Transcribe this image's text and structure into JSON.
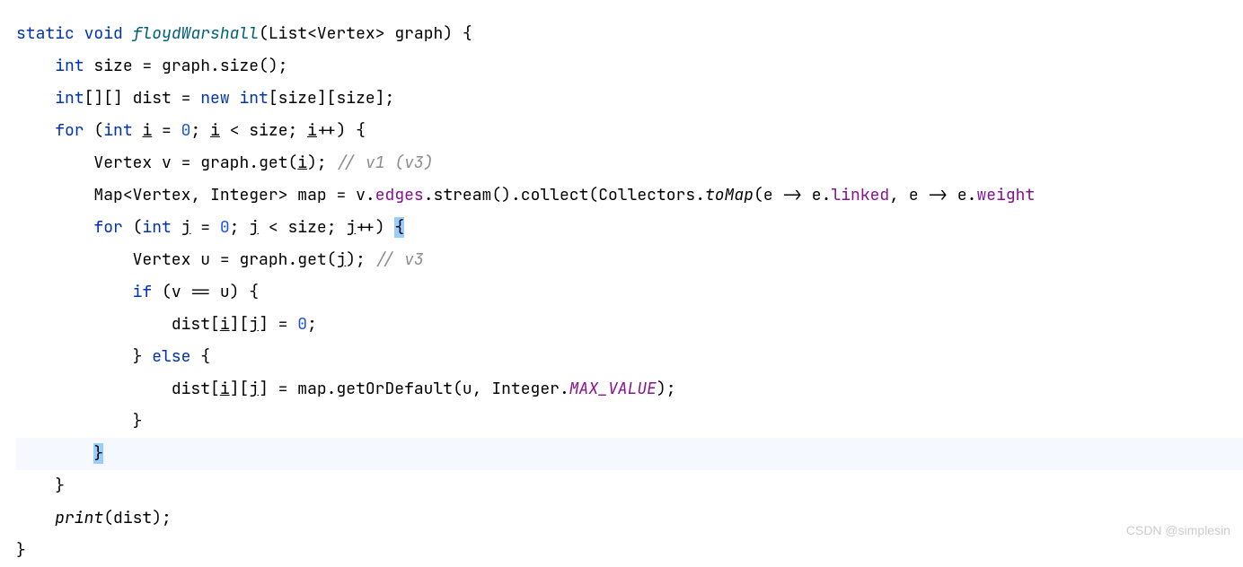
{
  "code": {
    "l1": {
      "kw_static": "static",
      "kw_void": "void",
      "method": "floydWarshall",
      "p1": "(",
      "type_list": "List",
      "lt": "<",
      "type_vertex": "Vertex",
      "gt": ">",
      "sp": " ",
      "param": "graph",
      "p2": ") {"
    },
    "l2": {
      "indent": "    ",
      "kw_int": "int",
      "sp": " ",
      "var": "size",
      "eq": " = ",
      "graph": "graph",
      "dot": ".",
      "size": "size",
      "call": "();"
    },
    "l3": {
      "indent": "    ",
      "kw_int": "int",
      "arr": "[][] ",
      "var": "dist",
      "eq": " = ",
      "kw_new": "new",
      "sp": " ",
      "kw_int2": "int",
      "b1": "[",
      "s1": "size",
      "b2": "][",
      "s2": "size",
      "b3": "];"
    },
    "l4": {
      "indent": "    ",
      "kw_for": "for",
      "sp": " (",
      "kw_int": "int",
      "sp2": " ",
      "i": "i",
      "eq": " = ",
      "zero": "0",
      "semi": "; ",
      "i2": "i",
      "lt": " < ",
      "size": "size",
      "semi2": "; ",
      "i3": "i",
      "inc": "++) {"
    },
    "l5": {
      "indent": "        ",
      "type": "Vertex",
      "sp": " ",
      "v": "v",
      "eq": " = ",
      "graph": "graph",
      "dot": ".",
      "get": "get",
      "p": "(",
      "i": "i",
      "p2": "); ",
      "comment": "// v1 (v3)"
    },
    "l6": {
      "indent": "        ",
      "type_map": "Map",
      "lt": "<",
      "vertex": "Vertex",
      "comma": ", ",
      "integer": "Integer",
      "gt": ">",
      "sp": " ",
      "map": "map",
      "eq": " = ",
      "v": "v",
      "dot": ".",
      "edges": "edges",
      "dot2": ".",
      "stream": "stream",
      "call1": "()",
      "dot3": ".",
      "collect": "collect",
      "p1": "(",
      "collectors": "Collectors",
      "dot4": ".",
      "tomap": "toMap",
      "p2": "(",
      "e1": "e -> e",
      "dot5": ".",
      "linked": "linked",
      "comma2": ", ",
      "e2": "e -> e",
      "dot6": ".",
      "weight": "weight"
    },
    "l7": {
      "indent": "        ",
      "kw_for": "for",
      "sp": " (",
      "kw_int": "int",
      "sp2": " ",
      "j": "j",
      "eq": " = ",
      "zero": "0",
      "semi": "; ",
      "j2": "j",
      "lt": " < ",
      "size": "size",
      "semi2": "; ",
      "j3": "j",
      "inc": "++) ",
      "brace": "{"
    },
    "l8": {
      "indent": "            ",
      "type": "Vertex",
      "sp": " ",
      "u": "u",
      "eq": " = ",
      "graph": "graph",
      "dot": ".",
      "get": "get",
      "p": "(",
      "j": "j",
      "p2": "); ",
      "comment": "// v3"
    },
    "l9": {
      "indent": "            ",
      "kw_if": "if",
      "sp": " (",
      "v": "v",
      "eqeq": " == ",
      "u": "u",
      "p": ") {"
    },
    "l10": {
      "indent": "                ",
      "dist": "dist",
      "b1": "[",
      "i": "i",
      "b2": "][",
      "j": "j",
      "b3": "] = ",
      "zero": "0",
      "semi": ";"
    },
    "l11": {
      "indent": "            } ",
      "kw_else": "else",
      "brace": " {"
    },
    "l12": {
      "indent": "                ",
      "dist": "dist",
      "b1": "[",
      "i": "i",
      "b2": "][",
      "j": "j",
      "b3": "] = ",
      "map": "map",
      "dot": ".",
      "getOrDefault": "getOrDefault",
      "p1": "(",
      "u": "u",
      "comma": ", ",
      "integer": "Integer",
      "dot2": ".",
      "max": "MAX_VALUE",
      "p2": ");"
    },
    "l13": {
      "indent": "            }"
    },
    "l14": {
      "indent": "        ",
      "brace": "}"
    },
    "l15": {
      "indent": "    }"
    },
    "l16": {
      "indent": "    ",
      "print": "print",
      "p": "(",
      "dist": "dist",
      "p2": ");"
    },
    "l17": {
      "text": "}"
    }
  },
  "watermark": "CSDN @simplesin"
}
